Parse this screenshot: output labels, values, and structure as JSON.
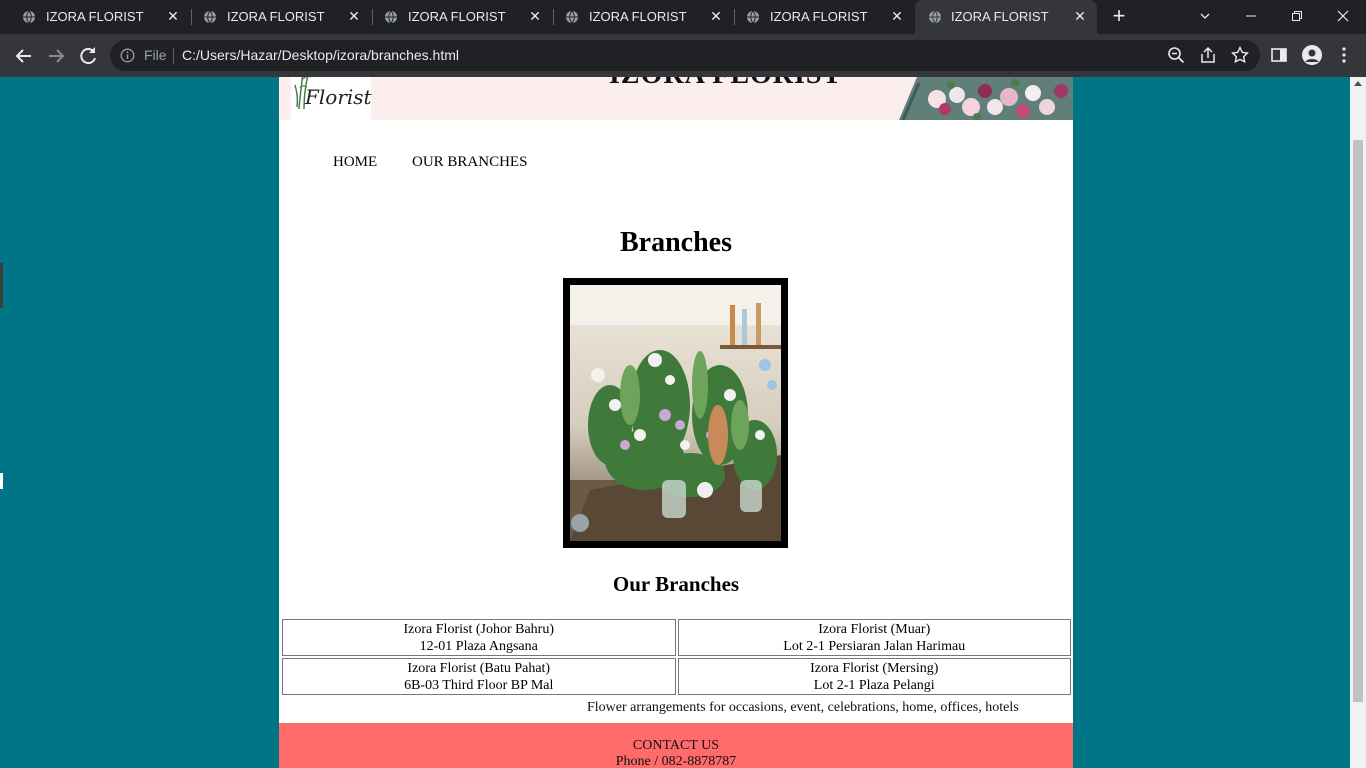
{
  "browser": {
    "tabs": [
      {
        "title": "IZORA FLORIST",
        "active": false
      },
      {
        "title": "IZORA FLORIST",
        "active": false
      },
      {
        "title": "IZORA FLORIST",
        "active": false
      },
      {
        "title": "IZORA FLORIST",
        "active": false
      },
      {
        "title": "IZORA FLORIST",
        "active": false
      },
      {
        "title": "IZORA FLORIST",
        "active": true
      }
    ],
    "new_tab_icon": "plus-icon",
    "file_label": "File",
    "url": "C:/Users/Hazar/Desktop/izora/branches.html",
    "window_controls": [
      "chevron-down-icon",
      "minimize-icon",
      "restore-icon",
      "close-icon"
    ]
  },
  "header": {
    "logo_text": "Florist",
    "title": "IZORA FLORIST"
  },
  "nav": {
    "home": "HOME",
    "branches": "OUR BRANCHES"
  },
  "main": {
    "heading": "Branches",
    "subheading": "Our Branches",
    "branches": [
      {
        "name": "Izora Florist (Johor Bahru)",
        "address": "12-01 Plaza Angsana"
      },
      {
        "name": "Izora Florist (Muar)",
        "address": "Lot 2-1 Persiaran Jalan Harimau"
      },
      {
        "name": "Izora Florist (Batu Pahat)",
        "address": "6B-03 Third Floor BP Mal"
      },
      {
        "name": "Izora Florist (Mersing)",
        "address": "Lot 2-1 Plaza Pelangi"
      }
    ],
    "tagline": "Flower arrangements for occasions, event, celebrations, home, offices, hotels"
  },
  "contact": {
    "title": "CONTACT US",
    "phone": "Phone / 082-8878787"
  },
  "colors": {
    "page_background": "#007585",
    "contact_background": "#ff6b6b",
    "banner_background": "#fbeeed"
  }
}
